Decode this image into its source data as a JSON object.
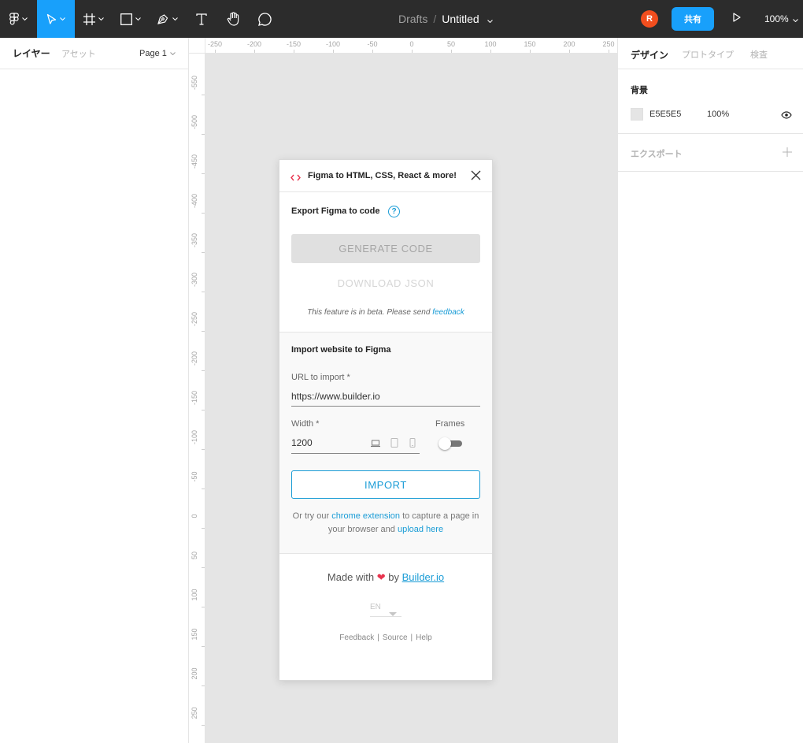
{
  "toolbar": {
    "breadcrumb_folder": "Drafts",
    "breadcrumb_sep": "/",
    "file_title": "Untitled",
    "avatar_initial": "R",
    "share_label": "共有",
    "zoom_label": "100%",
    "icons": [
      "figma-menu-icon",
      "move-tool-icon",
      "frame-tool-icon",
      "shape-tool-icon",
      "pen-tool-icon",
      "text-tool-icon",
      "hand-tool-icon",
      "comment-tool-icon",
      "play-icon"
    ],
    "accent": "#18a0fb"
  },
  "left_panel": {
    "tab_layers": "レイヤー",
    "tab_assets": "アセット",
    "page_label": "Page 1"
  },
  "rulers": {
    "top": [
      "-250",
      "-200",
      "-150",
      "-100",
      "-50",
      "0",
      "50",
      "100",
      "150",
      "200",
      "250"
    ],
    "left": [
      "-550",
      "-500",
      "-450",
      "-400",
      "-350",
      "-300",
      "-250",
      "-200",
      "-150",
      "-100",
      "-50",
      "0",
      "50",
      "100",
      "150",
      "200",
      "250"
    ]
  },
  "right_panel": {
    "tab_design": "デザイン",
    "tab_prototype": "プロトタイプ",
    "tab_inspect": "検査",
    "background_title": "背景",
    "background_hex": "E5E5E5",
    "background_opacity": "100%",
    "background_color": "#e5e5e5",
    "export_title": "エクスポート"
  },
  "plugin": {
    "title": "Figma to HTML, CSS, React & more!",
    "export_title": "Export Figma to code",
    "help_glyph": "?",
    "generate_label": "GENERATE CODE",
    "download_label": "DOWNLOAD JSON",
    "beta_text": "This feature is in beta. Please send",
    "beta_link": "feedback",
    "import_title": "Import website to Figma",
    "url_label": "URL to import *",
    "url_value": "https://www.builder.io",
    "width_label": "Width *",
    "width_value": "1200",
    "frames_label": "Frames",
    "frames_enabled": false,
    "import_label": "IMPORT",
    "ortry_prefix": "Or try our",
    "ortry_link1": "chrome extension",
    "ortry_mid": "to capture a page in your browser and",
    "ortry_link2": "upload here",
    "made_prefix": "Made with",
    "made_heart": "❤",
    "made_by": "by",
    "made_link": "Builder.io",
    "language": "EN",
    "footer_feedback": "Feedback",
    "footer_source": "Source",
    "footer_help": "Help",
    "footer_sep": "|",
    "link_color": "#1a9cd6"
  }
}
